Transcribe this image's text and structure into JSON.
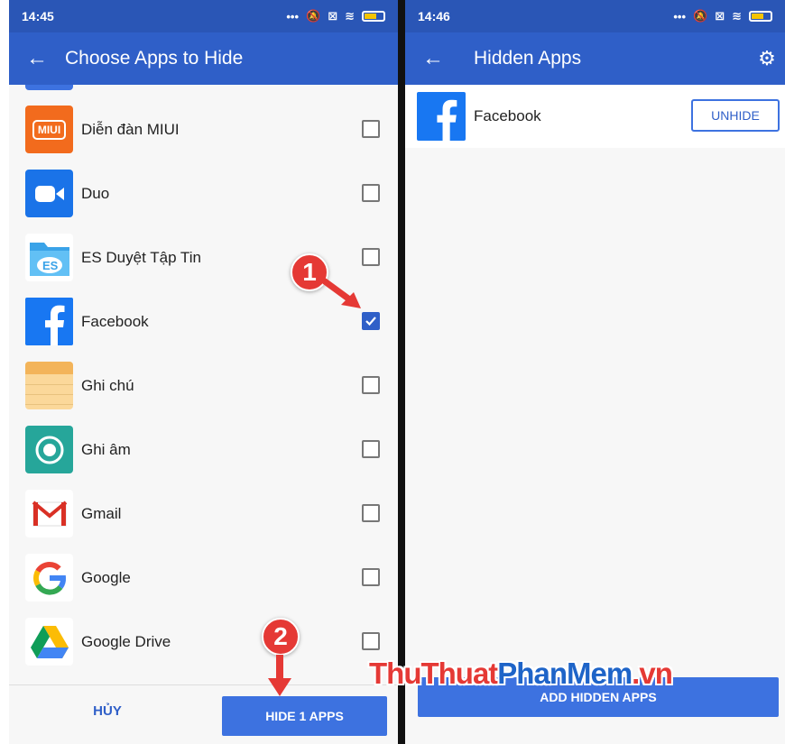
{
  "left_screen": {
    "status": {
      "time": "14:45"
    },
    "title": "Choose Apps to Hide",
    "apps": [
      {
        "label": "Diễn đàn MIUI",
        "icon": "miui-forum-icon",
        "icon_text": "MIUI",
        "checked": false
      },
      {
        "label": "Duo",
        "icon": "duo-video-icon",
        "checked": false
      },
      {
        "label": "ES Duyệt Tập Tin",
        "icon": "es-file-explorer-icon",
        "checked": false
      },
      {
        "label": "Facebook",
        "icon": "facebook-icon",
        "checked": true
      },
      {
        "label": "Ghi chú",
        "icon": "notes-icon",
        "checked": false
      },
      {
        "label": "Ghi âm",
        "icon": "recorder-icon",
        "checked": false
      },
      {
        "label": "Gmail",
        "icon": "gmail-icon",
        "checked": false
      },
      {
        "label": "Google",
        "icon": "google-icon",
        "checked": false
      },
      {
        "label": "Google Drive",
        "icon": "google-drive-icon",
        "checked": false
      }
    ],
    "cancel_label": "HỦY",
    "hide_button_label": "HIDE 1 APPS"
  },
  "right_screen": {
    "status": {
      "time": "14:46"
    },
    "title": "Hidden Apps",
    "hidden_apps": [
      {
        "label": "Facebook",
        "icon": "facebook-icon"
      }
    ],
    "unhide_label": "UNHIDE",
    "add_button_label": "ADD HIDDEN APPS"
  },
  "annotations": {
    "step1": "1",
    "step2": "2"
  },
  "watermark": {
    "part1": "ThuThuat",
    "part2": "PhanMem",
    "part3": ".vn"
  },
  "colors": {
    "status_bar": "#2a56b6",
    "app_bar": "#2f5fc8",
    "button": "#3d72e0",
    "badge": "#e53935",
    "checkbox_checked": "#2f5fc8"
  }
}
